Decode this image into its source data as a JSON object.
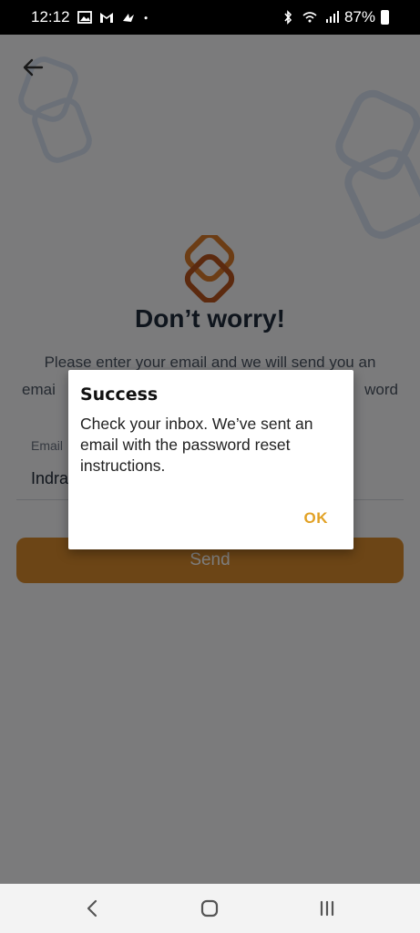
{
  "status_bar": {
    "time": "12:12",
    "left_icons": [
      "gallery-icon",
      "gmail-icon",
      "bird-icon",
      "dot-icon"
    ],
    "right_icons": [
      "bluetooth-icon",
      "wifi-calling-icon",
      "signal-icon"
    ],
    "battery": "87%"
  },
  "header": {
    "back_icon": "arrow-left-icon"
  },
  "main": {
    "title": "Don’t worry!",
    "subtitle_line1": "Please enter your email and we will send you an",
    "subtitle_line2_left": "emai",
    "subtitle_line2_right": "word",
    "email_label": "Email",
    "email_value": "Indra",
    "send_label": "Send"
  },
  "dialog": {
    "title": "Success",
    "message": "Check your inbox. We’ve sent an email with the password reset instructions.",
    "ok_label": "OK"
  },
  "colors": {
    "accent": "#d98a2d",
    "dialog_ok": "#e2a226",
    "title": "#1e2a3b"
  },
  "nav_bar": {
    "icons": [
      "back-nav-icon",
      "home-nav-icon",
      "recents-nav-icon"
    ]
  }
}
